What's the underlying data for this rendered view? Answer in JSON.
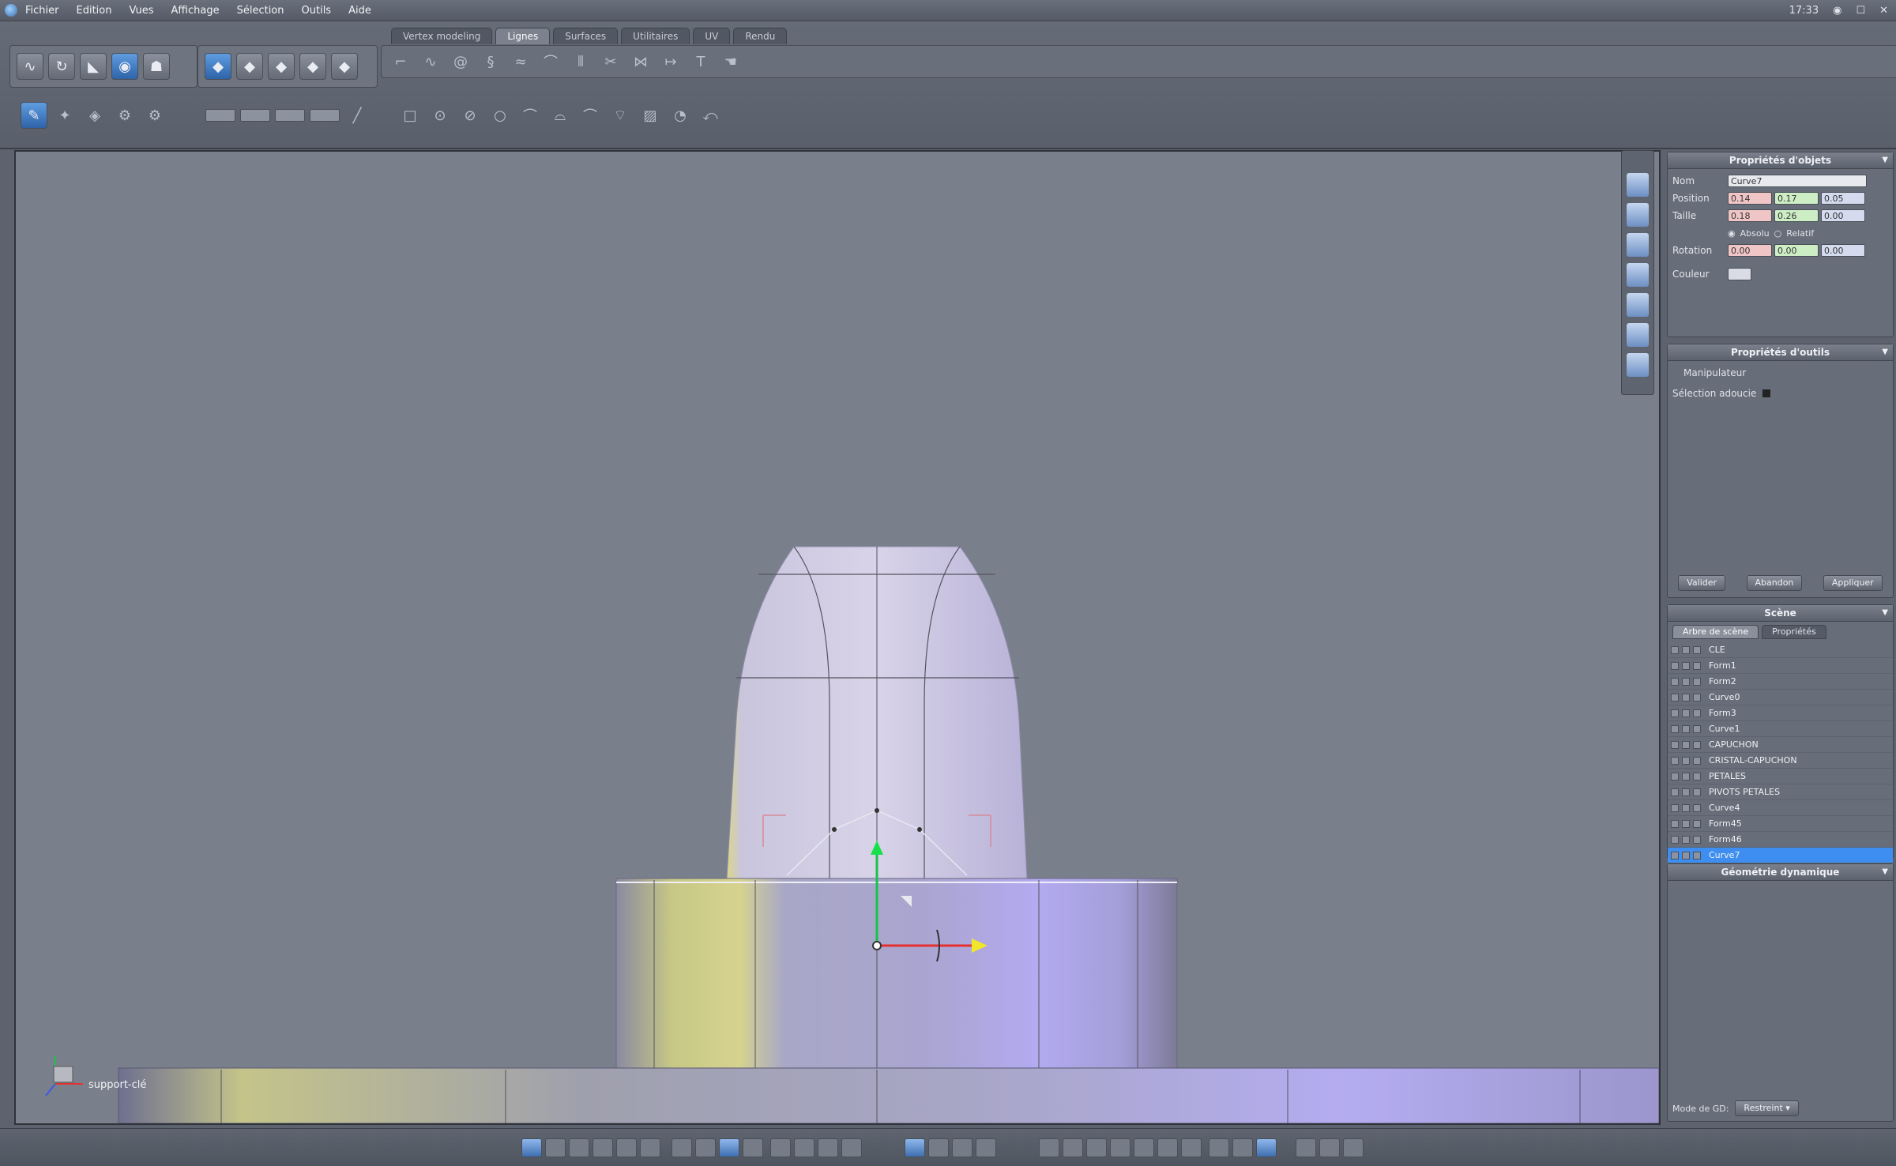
{
  "menubar": {
    "items": [
      "Fichier",
      "Edition",
      "Vues",
      "Affichage",
      "Sélection",
      "Outils",
      "Aide"
    ],
    "clock": "17:33"
  },
  "tabs": [
    {
      "label": "Vertex modeling",
      "active": false
    },
    {
      "label": "Lignes",
      "active": true
    },
    {
      "label": "Surfaces",
      "active": false
    },
    {
      "label": "Utilitaires",
      "active": false
    },
    {
      "label": "UV",
      "active": false
    },
    {
      "label": "Rendu",
      "active": false
    }
  ],
  "viewport": {
    "object_label": "support-clé"
  },
  "object_props": {
    "title": "Propriétés d'objets",
    "name_label": "Nom",
    "name_value": "Curve7",
    "position_label": "Position",
    "position": [
      "0.14",
      "0.17",
      "0.05"
    ],
    "size_label": "Taille",
    "size": [
      "0.18",
      "0.26",
      "0.00"
    ],
    "absolute_label": "Absolu",
    "relative_label": "Relatif",
    "rotation_label": "Rotation",
    "rotation": [
      "0.00",
      "0.00",
      "0.00"
    ],
    "color_label": "Couleur"
  },
  "tool_props": {
    "title": "Propriétés d'outils",
    "tool_name": "Manipulateur",
    "soft_selection_label": "Sélection adoucie",
    "buttons": [
      "Valider",
      "Abandon",
      "Appliquer"
    ]
  },
  "scene": {
    "title": "Scène",
    "tabs": [
      "Arbre de scène",
      "Propriétés"
    ],
    "items": [
      {
        "label": "CLE",
        "selected": false
      },
      {
        "label": "Form1",
        "selected": false
      },
      {
        "label": "Form2",
        "selected": false
      },
      {
        "label": "Curve0",
        "selected": false
      },
      {
        "label": "Form3",
        "selected": false
      },
      {
        "label": "Curve1",
        "selected": false
      },
      {
        "label": "CAPUCHON",
        "selected": false
      },
      {
        "label": "CRISTAL-CAPUCHON",
        "selected": false
      },
      {
        "label": "PETALES",
        "selected": false
      },
      {
        "label": "PIVOTS PETALES",
        "selected": false
      },
      {
        "label": "Curve4",
        "selected": false
      },
      {
        "label": "Form45",
        "selected": false
      },
      {
        "label": "Form46",
        "selected": false
      },
      {
        "label": "Curve7",
        "selected": true
      }
    ]
  },
  "dynamic_geometry": {
    "title": "Géométrie dynamique",
    "mode_label": "Mode de GD:",
    "mode_value": "Restreint"
  },
  "colors": {
    "accent": "#3d8ef0",
    "object_body": "#bdb9dc",
    "object_highlight": "#d9d68a"
  }
}
